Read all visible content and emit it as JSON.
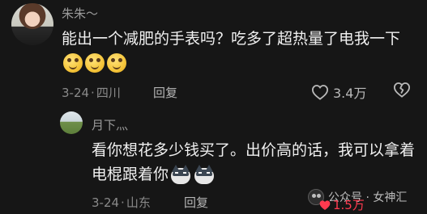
{
  "comment": {
    "username": "朱朱～",
    "text": "能出一个减肥的手表吗？吃多了超热量了电我一下",
    "emoji": [
      "grin-emoji",
      "grin-emoji",
      "grin-emoji"
    ],
    "date": "3-24",
    "location": "四川",
    "reply_label": "回复",
    "like_count": "3.4万"
  },
  "reply": {
    "username": "月下灬",
    "text": "看你想花多少钱买了。出价高的话，我可以拿着电棍跟着你",
    "emoji": [
      "husky-emoji",
      "husky-emoji"
    ],
    "date": "3-24",
    "location": "山东",
    "reply_label": "回复"
  },
  "watermark": {
    "text": "公众号 · 女神汇"
  },
  "overlay": {
    "count": "1.5万",
    "color": "#ff3a4f"
  },
  "colors": {
    "background": "#161616",
    "text": "#f0f0f0",
    "meta": "#8a8a8a"
  }
}
